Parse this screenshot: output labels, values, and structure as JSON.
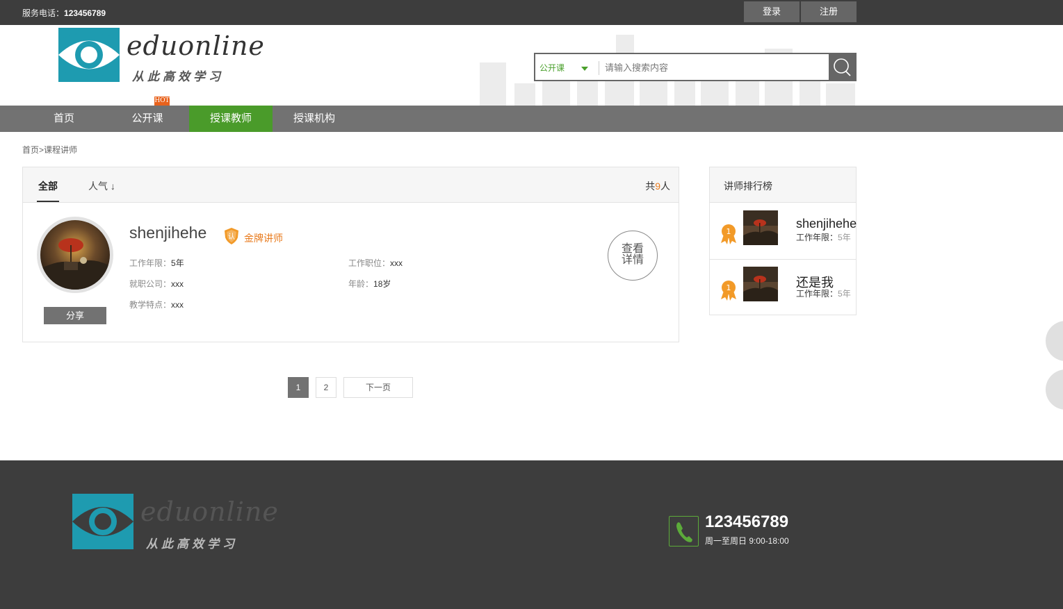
{
  "topbar": {
    "phone_label": "服务电话：",
    "phone_number": "123456789",
    "login_label": "登录",
    "register_label": "注册"
  },
  "header": {
    "logo_text": "eduonline",
    "logo_slogan": "从此高效学习",
    "search": {
      "category": "公开课",
      "placeholder": "请输入搜索内容"
    }
  },
  "nav": {
    "items": [
      {
        "label": "首页",
        "active": false
      },
      {
        "label": "公开课",
        "active": false
      },
      {
        "label": "授课教师",
        "active": true
      },
      {
        "label": "授课机构",
        "active": false
      }
    ],
    "hot_badge": "HOT"
  },
  "breadcrumb": {
    "home": "首页",
    "separator": ">",
    "current": "课程讲师"
  },
  "list": {
    "tabs": [
      {
        "label": "全部",
        "active": true
      },
      {
        "label": "人气 ↓",
        "active": false
      }
    ],
    "count_prefix": "共",
    "count": "9",
    "count_suffix": "人"
  },
  "teacher": {
    "name": "shenjihehe",
    "badge": "金牌讲师",
    "work_years_label": "工作年限：",
    "work_years": "5年",
    "position_label": "工作职位：",
    "position": "xxx",
    "company_label": "就职公司：",
    "company": "xxx",
    "age_label": "年龄：",
    "age": "18岁",
    "feature_label": "教学特点：",
    "feature": "xxx",
    "share_label": "分享",
    "detail_label_1": "查看",
    "detail_label_2": "详情"
  },
  "pagination": {
    "pages": [
      "1",
      "2"
    ],
    "current": "1",
    "next_label": "下一页"
  },
  "ranking": {
    "title": "讲师排行榜",
    "items": [
      {
        "rank": "1",
        "name": "shenjihehe",
        "exp_label": "工作年限：",
        "exp": "5年"
      },
      {
        "rank": "1",
        "name": "还是我",
        "exp_label": "工作年限：",
        "exp": "5年"
      }
    ]
  },
  "footer": {
    "logo_text": "eduonline",
    "logo_slogan": "从此高效学习",
    "phone": "123456789",
    "hours": "周一至周日 9:00-18:00"
  },
  "colors": {
    "accent_green": "#4a9b2a",
    "accent_orange": "#e87a1c",
    "dark_bg": "#3d3d3d",
    "nav_gray": "#727272",
    "logo_teal": "#1e9bb0"
  }
}
